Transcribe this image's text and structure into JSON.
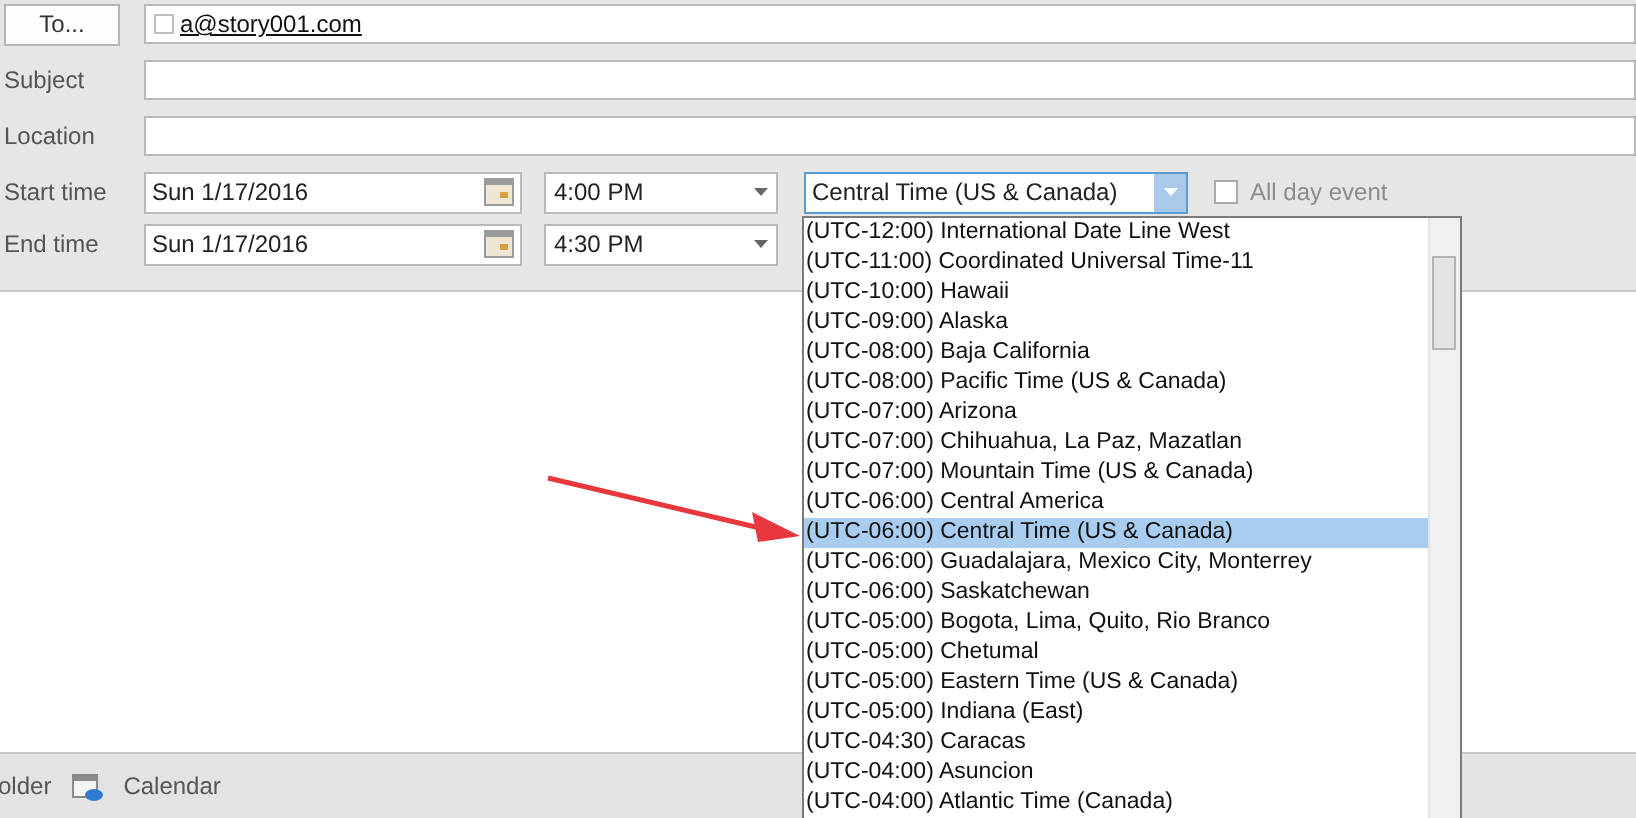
{
  "to_button": "To...",
  "recipients": [
    {
      "address": "a@story001.com"
    }
  ],
  "fields": [
    {
      "label": "Subject"
    },
    {
      "label": "Location"
    }
  ],
  "time_rows": [
    {
      "label": "Start time",
      "date": "Sun 1/17/2016",
      "time": "4:00 PM"
    },
    {
      "label": "End time",
      "date": "Sun 1/17/2016",
      "time": "4:30 PM"
    }
  ],
  "timezone": {
    "value": "Central Time (US & Canada)",
    "expanded": true,
    "options": [
      {
        "label": "(UTC-12:00) International Date Line West",
        "selected": false
      },
      {
        "label": "(UTC-11:00) Coordinated Universal Time-11",
        "selected": false
      },
      {
        "label": "(UTC-10:00) Hawaii",
        "selected": false
      },
      {
        "label": "(UTC-09:00) Alaska",
        "selected": false
      },
      {
        "label": "(UTC-08:00) Baja California",
        "selected": false
      },
      {
        "label": "(UTC-08:00) Pacific Time (US & Canada)",
        "selected": false
      },
      {
        "label": "(UTC-07:00) Arizona",
        "selected": false
      },
      {
        "label": "(UTC-07:00) Chihuahua, La Paz, Mazatlan",
        "selected": false
      },
      {
        "label": "(UTC-07:00) Mountain Time (US & Canada)",
        "selected": false
      },
      {
        "label": "(UTC-06:00) Central America",
        "selected": false
      },
      {
        "label": "(UTC-06:00) Central Time (US & Canada)",
        "selected": true
      },
      {
        "label": "(UTC-06:00) Guadalajara, Mexico City, Monterrey",
        "selected": false
      },
      {
        "label": "(UTC-06:00) Saskatchewan",
        "selected": false
      },
      {
        "label": "(UTC-05:00) Bogota, Lima, Quito, Rio Branco",
        "selected": false
      },
      {
        "label": "(UTC-05:00) Chetumal",
        "selected": false
      },
      {
        "label": "(UTC-05:00) Eastern Time (US & Canada)",
        "selected": false
      },
      {
        "label": "(UTC-05:00) Indiana (East)",
        "selected": false
      },
      {
        "label": "(UTC-04:30) Caracas",
        "selected": false
      },
      {
        "label": "(UTC-04:00) Asuncion",
        "selected": false
      },
      {
        "label": "(UTC-04:00) Atlantic Time (Canada)",
        "selected": false
      }
    ]
  },
  "all_day": {
    "label": "All day event",
    "checked": false
  },
  "status_bar": {
    "folder_label": "older",
    "calendar_label": "Calendar"
  }
}
